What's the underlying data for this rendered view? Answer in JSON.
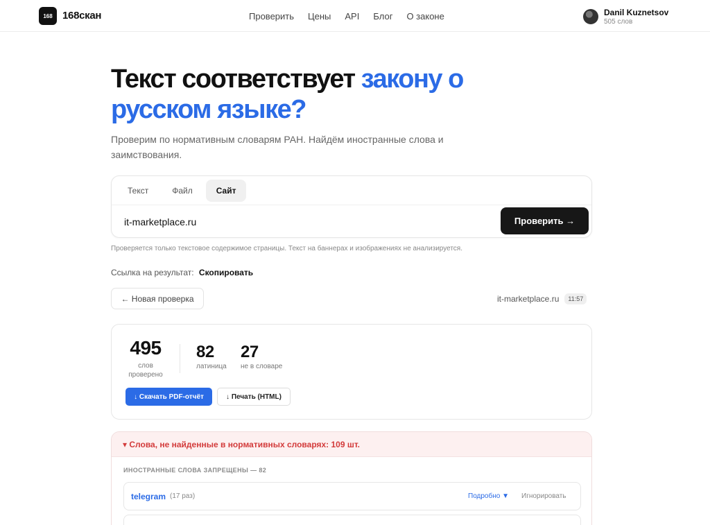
{
  "header": {
    "logo_badge": "168",
    "logo_text": "168скан",
    "nav": [
      "Проверить",
      "Цены",
      "API",
      "Блог",
      "О законе"
    ],
    "user_name": "Danil Kuznetsov",
    "user_words": "505 слов"
  },
  "hero": {
    "title_plain": "Текст соответствует ",
    "title_accent": "закону о русском языке?",
    "subtitle": "Проверим по нормативным словарям РАН. Найдём иностранные слова и заимствования."
  },
  "checker": {
    "tabs": [
      "Текст",
      "Файл",
      "Сайт"
    ],
    "active_tab": "Сайт",
    "url_value": "it-marketplace.ru",
    "check_button": "Проверить →",
    "note": "Проверяется только текстовое содержимое страницы. Текст на баннерах и изображениях не анализируется."
  },
  "share": {
    "label": "Ссылка на результат:",
    "action": "Скопировать"
  },
  "result_bar": {
    "new_check": "← Новая проверка",
    "site": "it-marketplace.ru",
    "time": "11:57"
  },
  "stats": {
    "total": "495",
    "total_label": "слов проверено",
    "latin": "82",
    "latin_label": "латиница",
    "not_in_dict": "27",
    "not_in_dict_label": "не в словаре",
    "pdf_button": "↓ Скачать PDF-отчёт",
    "print_button": "↓ Печать (HTML)"
  },
  "issues": {
    "header": "▾ Слова, не найденные в нормативных словарях: 109 шт.",
    "section": "ИНОСТРАННЫЕ СЛОВА ЗАПРЕЩЕНЫ — 82",
    "words": [
      {
        "word": "telegram",
        "count": "(17 раз)",
        "more": "Подробно ▼",
        "ignore": "Игнорировать"
      }
    ]
  },
  "colors": {
    "accent": "#2b6be6",
    "danger": "#d33a3a",
    "dark_button": "#171717"
  }
}
